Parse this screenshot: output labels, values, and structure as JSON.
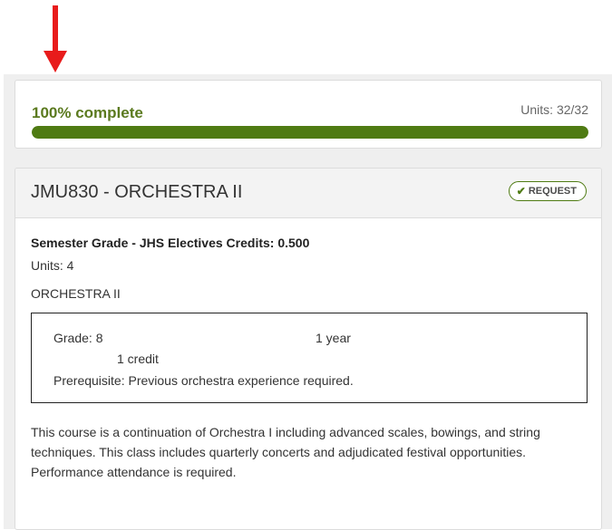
{
  "progress": {
    "label": "100% complete",
    "units": "Units: 32/32",
    "fraction": 1.0,
    "color": "#4f7b13"
  },
  "course": {
    "title": "JMU830 - ORCHESTRA II",
    "request_label": "REQUEST",
    "grade_credits": "Semester Grade - JHS Electives Credits: 0.500",
    "units": "Units: 4",
    "name": "ORCHESTRA II",
    "details": {
      "grade": "Grade: 8",
      "duration": "1 year",
      "credit": "1 credit",
      "prerequisite": "Prerequisite: Previous orchestra experience required."
    },
    "description": "This course is a continuation of Orchestra I including advanced scales, bowings, and string techniques. This class includes quarterly concerts and adjudicated festival opportunities.  Performance attendance is required."
  },
  "icons": {
    "annotation": "red-down-arrow-icon",
    "request": "check-icon"
  }
}
